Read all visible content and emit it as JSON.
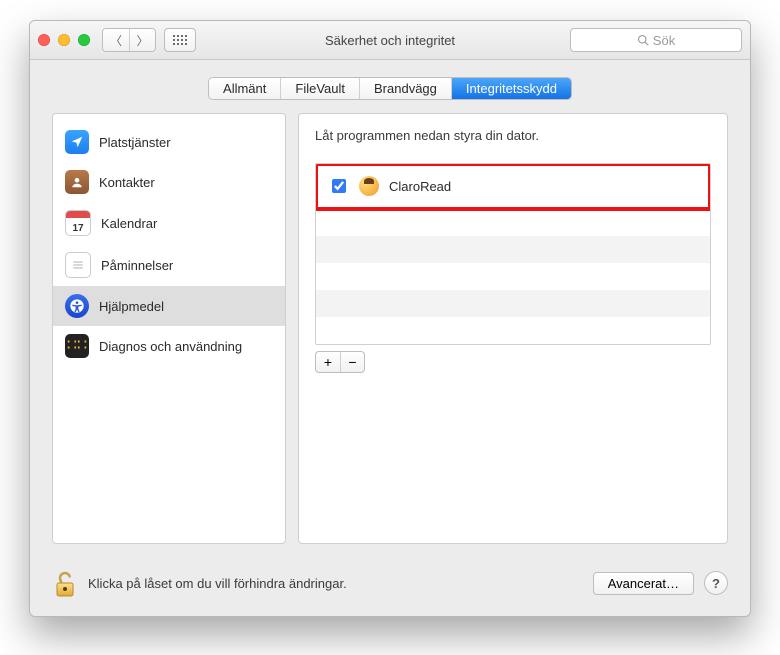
{
  "window": {
    "title": "Säkerhet och integritet"
  },
  "search": {
    "placeholder": "Sök"
  },
  "tabs": [
    {
      "label": "Allmänt",
      "active": false
    },
    {
      "label": "FileVault",
      "active": false
    },
    {
      "label": "Brandvägg",
      "active": false
    },
    {
      "label": "Integritetsskydd",
      "active": true
    }
  ],
  "sidebar": {
    "items": [
      {
        "label": "Platstjänster"
      },
      {
        "label": "Kontakter"
      },
      {
        "label": "Kalendrar",
        "day": "17"
      },
      {
        "label": "Påminnelser"
      },
      {
        "label": "Hjälpmedel",
        "selected": true
      },
      {
        "label": "Diagnos och användning"
      }
    ]
  },
  "right": {
    "caption": "Låt programmen nedan styra din dator.",
    "apps": [
      {
        "name": "ClaroRead",
        "checked": true
      }
    ]
  },
  "footer": {
    "lock_text": "Klicka på låset om du vill förhindra ändringar.",
    "advanced": "Avancerat…"
  }
}
